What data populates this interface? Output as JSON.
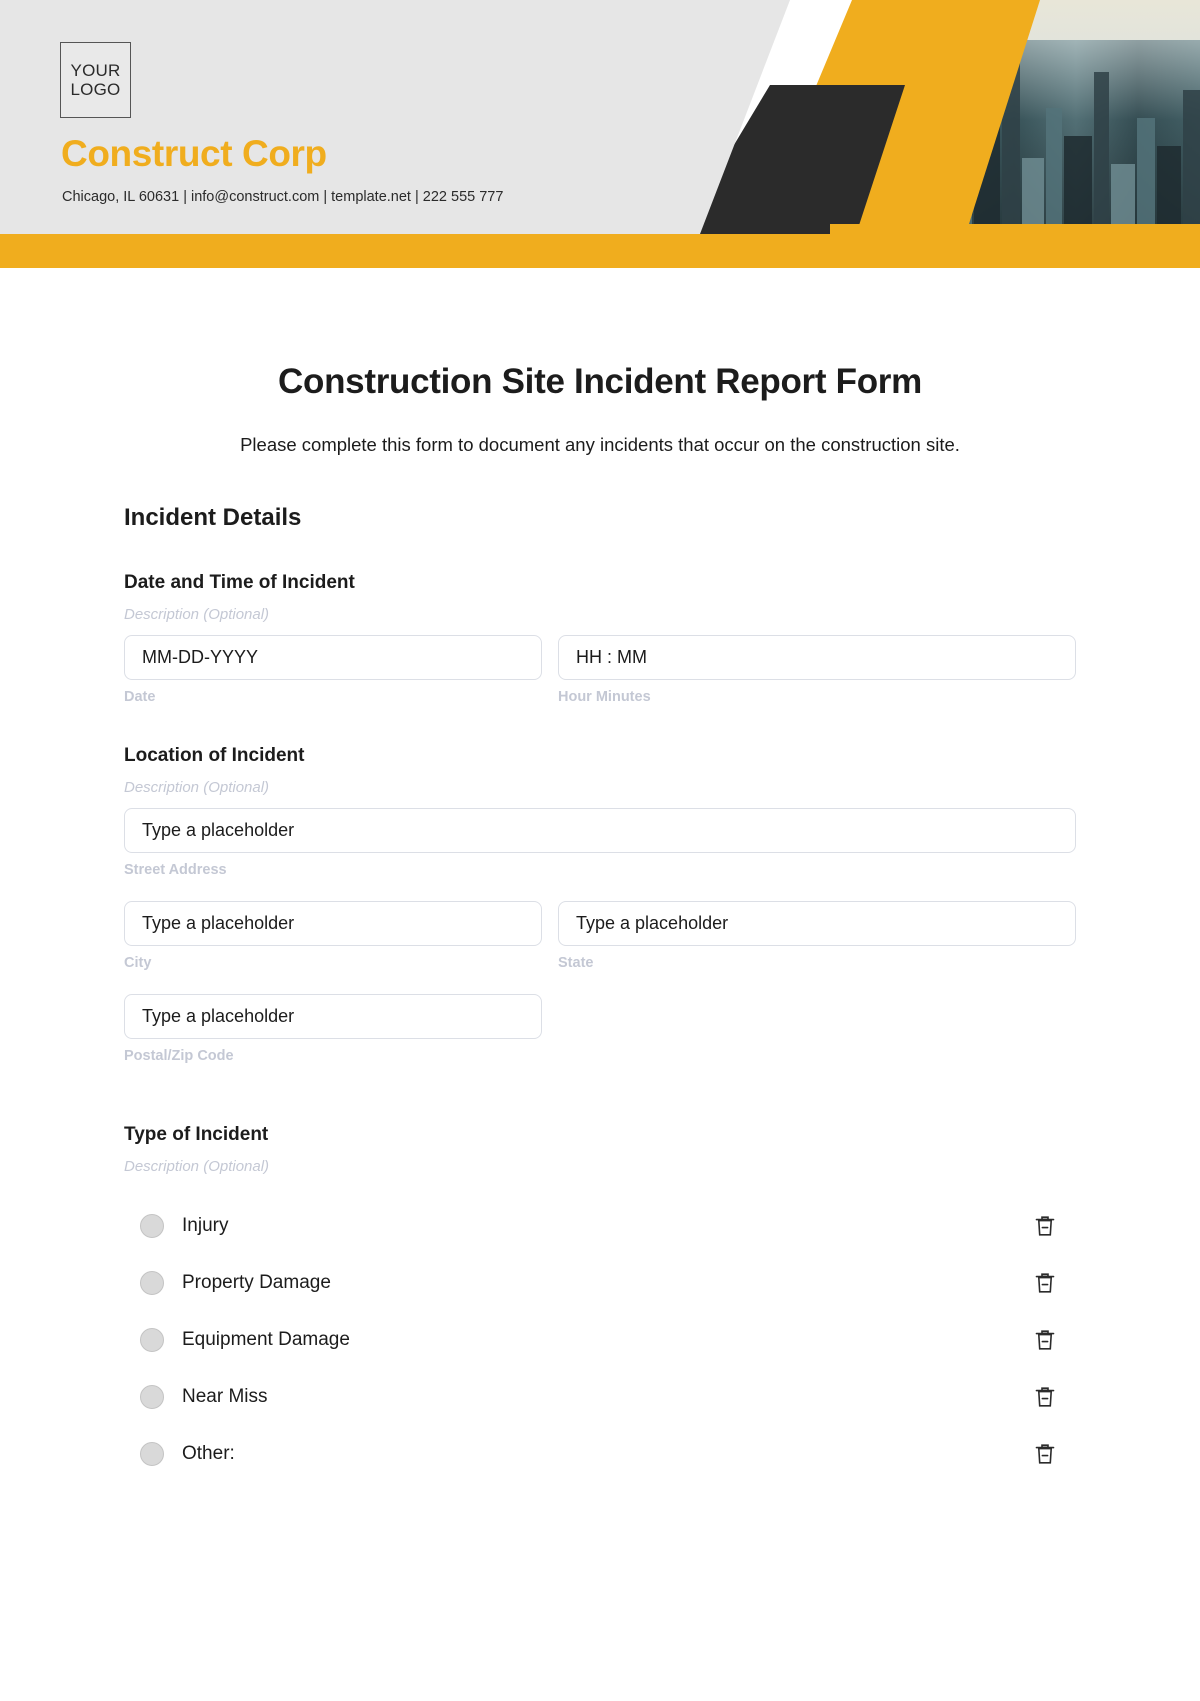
{
  "header": {
    "logo_line1": "YOUR",
    "logo_line2": "LOGO",
    "brand_name": "Construct Corp",
    "contact_line": "Chicago, IL 60631 | info@construct.com | template.net | 222 555 777",
    "colors": {
      "accent_yellow": "#f0ad1e",
      "accent_yellow_dark": "#d59a17",
      "dark": "#2b2b2b",
      "panel_gray": "#e6e6e6"
    }
  },
  "form": {
    "title": "Construction Site Incident Report Form",
    "subtitle": "Please complete this form to document any incidents that occur on the construction site.",
    "section_title": "Incident Details",
    "optional_description": "Description (Optional)",
    "placeholder_text": "Type a placeholder",
    "fields": {
      "datetime": {
        "label": "Date and Time of Incident",
        "description": "Description (Optional)",
        "date_value": "MM-DD-YYYY",
        "date_sublabel": "Date",
        "time_value": "HH : MM",
        "time_sublabel": "Hour Minutes"
      },
      "location": {
        "label": "Location of Incident",
        "description": "Description (Optional)",
        "street_value": "Type a placeholder",
        "street_sublabel": "Street Address",
        "city_value": "Type a placeholder",
        "city_sublabel": "City",
        "state_value": "Type a placeholder",
        "state_sublabel": "State",
        "postal_value": "Type a placeholder",
        "postal_sublabel": "Postal/Zip Code"
      },
      "incident_type": {
        "label": "Type of Incident",
        "description": "Description (Optional)",
        "options": [
          {
            "label": "Injury",
            "icon": "trash-icon",
            "selected": false
          },
          {
            "label": "Property Damage",
            "icon": "trash-icon",
            "selected": false
          },
          {
            "label": "Equipment Damage",
            "icon": "trash-icon",
            "selected": false
          },
          {
            "label": "Near Miss",
            "icon": "trash-icon",
            "selected": false
          },
          {
            "label": "Other:",
            "icon": "trash-icon",
            "selected": false
          }
        ]
      }
    }
  }
}
